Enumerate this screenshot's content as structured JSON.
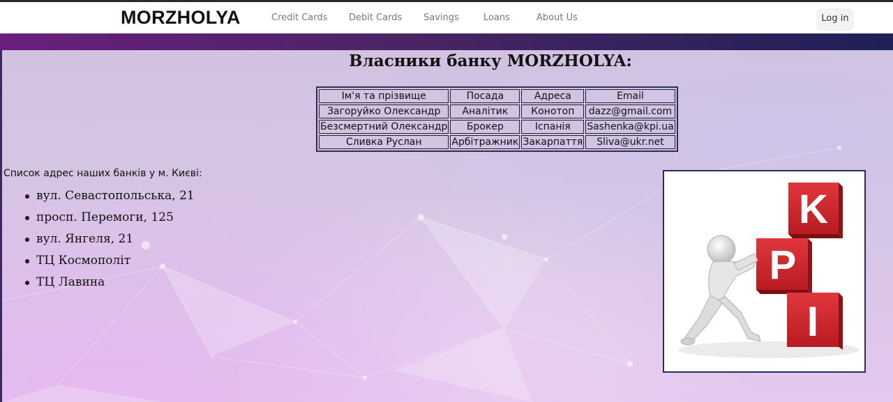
{
  "nav": {
    "brand": "MORZHOLYA",
    "links": [
      "Credit Cards",
      "Debit Cards",
      "Savings",
      "Loans",
      "About Us"
    ],
    "login_label": "Log in"
  },
  "main": {
    "heading": "Власники банку MORZHOLYA:",
    "owners_table": {
      "headers": [
        "Ім'я та прізвище",
        "Посада",
        "Адреса",
        "Email"
      ],
      "rows": [
        [
          "Загоруйко Олександр",
          "Аналітик",
          "Конотоп",
          "dazz@gmail.com"
        ],
        [
          "Безсмертний Олександр",
          "Брокер",
          "Іспанія",
          "Sashenka@kpi.ua"
        ],
        [
          "Сливка Руслан",
          "Арбітражник",
          "Закарпаття",
          "Sliva@ukr.net"
        ]
      ]
    },
    "addresses_title": "Список адрес наших банків у м. Києві:",
    "addresses": [
      "вул. Севастопольська, 21",
      "просп. Перемоги, 125",
      "вул. Янгеля, 21",
      "ТЦ Космополіт",
      "ТЦ Лавина"
    ],
    "image": {
      "letters": [
        "K",
        "P",
        "I"
      ],
      "cube_color": "#d2232a"
    }
  },
  "colors": {
    "band_start": "#6a1f7e",
    "band_end": "#1f2057",
    "frame_border": "#2b2a5a"
  }
}
